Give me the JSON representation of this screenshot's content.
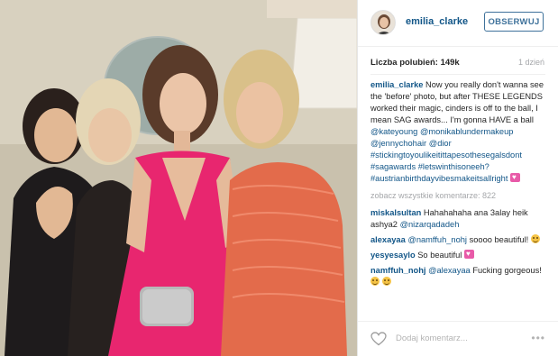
{
  "post": {
    "username": "emilia_clarke",
    "follow_label": "OBSERWUJ",
    "likes_label": "Liczba polubień: 149k",
    "time_ago": "1 dzień",
    "caption_user": "emilia_clarke",
    "caption_text": "Now you really don't wanna see the 'before' photo, but after THESE LEGENDS worked their magic, cinders is off to the ball, I mean SAG awards... I'm gonna HAVE a ball",
    "mentions": [
      "@kateyoung",
      "@monikablundermakeup",
      "@jennychohair",
      "@dior"
    ],
    "hashtags": [
      "#stickingtoyoulikeitittapesothesegalsdont",
      "#sagawards",
      "#letswinthisoneeh?",
      "#austrianbirthdayvibesmakeitsallright"
    ],
    "more_comments": "zobacz wszystkie komentarze: 822",
    "add_comment_placeholder": "Dodaj komentarz...",
    "options_label": "•••"
  },
  "comments": [
    {
      "user": "miskalsultan",
      "text": "Hahahahaha ana 3alay heik ashya2",
      "mention": "@nizarqadadeh"
    },
    {
      "user": "alexayaa",
      "mention": "@namffuh_nohj",
      "text": "soooo beautiful!"
    },
    {
      "user": "yesyesaylo",
      "text": "So beautiful"
    },
    {
      "user": "namffuh_nohj",
      "mention": "@alexayaa",
      "text": "Fucking gorgeous!"
    }
  ],
  "colors": {
    "link": "#125688",
    "follow_border": "#3f729b",
    "dress": "#e8266f",
    "muted": "#a5a7aa"
  },
  "icons": [
    "heart-icon",
    "options-icon",
    "emoji-smile-icon",
    "emoji-heart-icon"
  ]
}
